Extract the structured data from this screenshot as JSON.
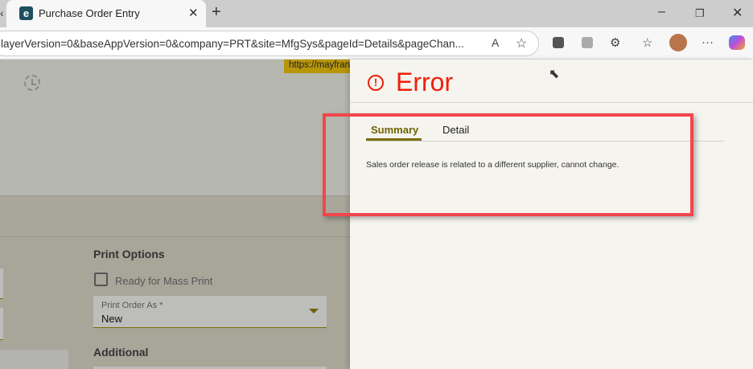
{
  "browser": {
    "tab_title": "Purchase Order Entry",
    "favicon_letter": "e",
    "url": "layerVersion=0&baseAppVersion=0&company=PRT&site=MfgSys&pageId=Details&pageChan...",
    "status_url": "https://mayfran"
  },
  "form": {
    "print_options_heading": "Print Options",
    "ready_mass_print_label": "Ready for Mass Print",
    "ready_mass_print_checked": false,
    "print_order_as_label": "Print Order As *",
    "print_order_as_value": "New",
    "additional_heading": "Additional"
  },
  "error_panel": {
    "title": "Error",
    "tabs": [
      {
        "label": "Summary",
        "active": true
      },
      {
        "label": "Detail",
        "active": false
      }
    ],
    "message": "Sales order release is related to a different supplier, cannot change."
  },
  "colors": {
    "error": "#f0200a",
    "accent": "#7a6d0a",
    "highlight": "#f2454d"
  }
}
